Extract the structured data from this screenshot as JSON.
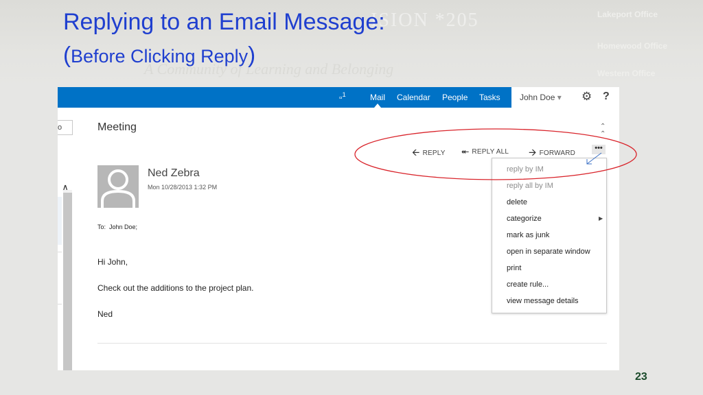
{
  "slide": {
    "title": "Replying to an Email Message:",
    "subtitle_open": "(",
    "subtitle": "Before Clicking Reply",
    "subtitle_close": ")",
    "page_number": "23",
    "title_color": "#1f3fcf"
  },
  "topbar": {
    "color": "#0072c6",
    "notification_icon": "calendar-notification-icon",
    "notification_count": "1",
    "nav": [
      "Mail",
      "Calendar",
      "People",
      "Tasks"
    ],
    "active_nav": "Mail",
    "user_name": "John Doe",
    "user_caret": "▾",
    "settings_icon": "gear-icon",
    "help_label": "?"
  },
  "search": {
    "partial_icon": "o"
  },
  "message": {
    "subject": "Meeting",
    "collapse_icon": "double-chevron-up-icon",
    "sender": "Ned Zebra",
    "date": "Mon 10/28/2013 1:32 PM",
    "to_label": "To:",
    "to_value": "John Doe;",
    "body": [
      "Hi John,",
      "Check out the additions to the project plan.",
      "Ned"
    ]
  },
  "actions": {
    "reply": "REPLY",
    "reply_all": "REPLY ALL",
    "forward": "FORWARD",
    "more": "•••"
  },
  "menu": {
    "items": [
      {
        "label": "reply by IM",
        "enabled": false
      },
      {
        "label": "reply all by IM",
        "enabled": false
      },
      {
        "label": "delete",
        "enabled": true
      },
      {
        "label": "categorize",
        "enabled": true
      },
      {
        "label": "mark as junk",
        "enabled": true
      },
      {
        "label": "open in separate window",
        "enabled": true
      },
      {
        "label": "print",
        "enabled": true
      },
      {
        "label": "create rule...",
        "enabled": true
      },
      {
        "label": "view message details",
        "enabled": true
      }
    ]
  },
  "annotation": {
    "ellipse_color": "#d9232a",
    "pointer_color": "#3a6fc4"
  }
}
